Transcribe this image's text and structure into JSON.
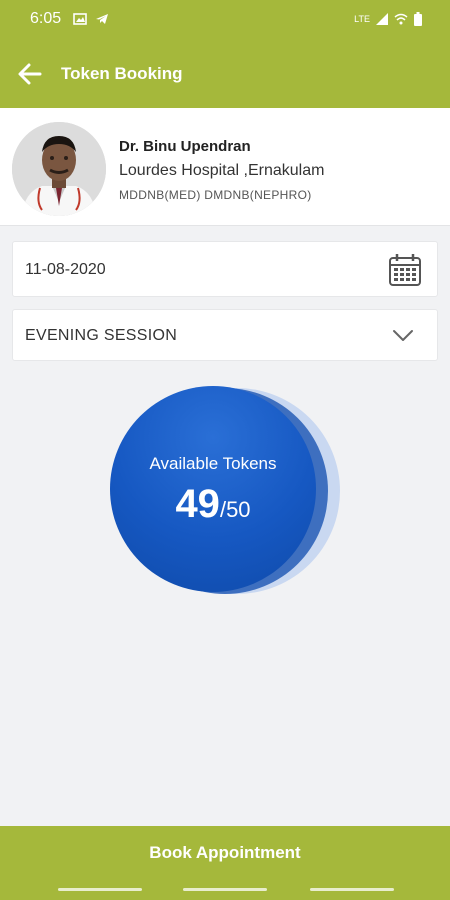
{
  "status_bar": {
    "time": "6:05",
    "net_label": "LTE"
  },
  "app_bar": {
    "title": "Token Booking"
  },
  "doctor": {
    "name": "Dr. Binu Upendran",
    "hospital": "Lourdes Hospital ,Ernakulam",
    "qualifications": "MDDNB(MED) DMDNB(NEPHRO)"
  },
  "booking": {
    "date": "11-08-2020",
    "session": "EVENING SESSION"
  },
  "tokens": {
    "label": "Available Tokens",
    "available": "49",
    "separator": "/",
    "total": "50"
  },
  "actions": {
    "book_label": "Book Appointment"
  },
  "colors": {
    "primary": "#a5b83b",
    "token_blue": "#1658c2"
  },
  "icons": [
    "image-icon",
    "telegram-icon",
    "signal-icon",
    "wifi-icon",
    "battery-icon",
    "back-arrow-icon",
    "calendar-icon",
    "chevron-down-icon"
  ]
}
